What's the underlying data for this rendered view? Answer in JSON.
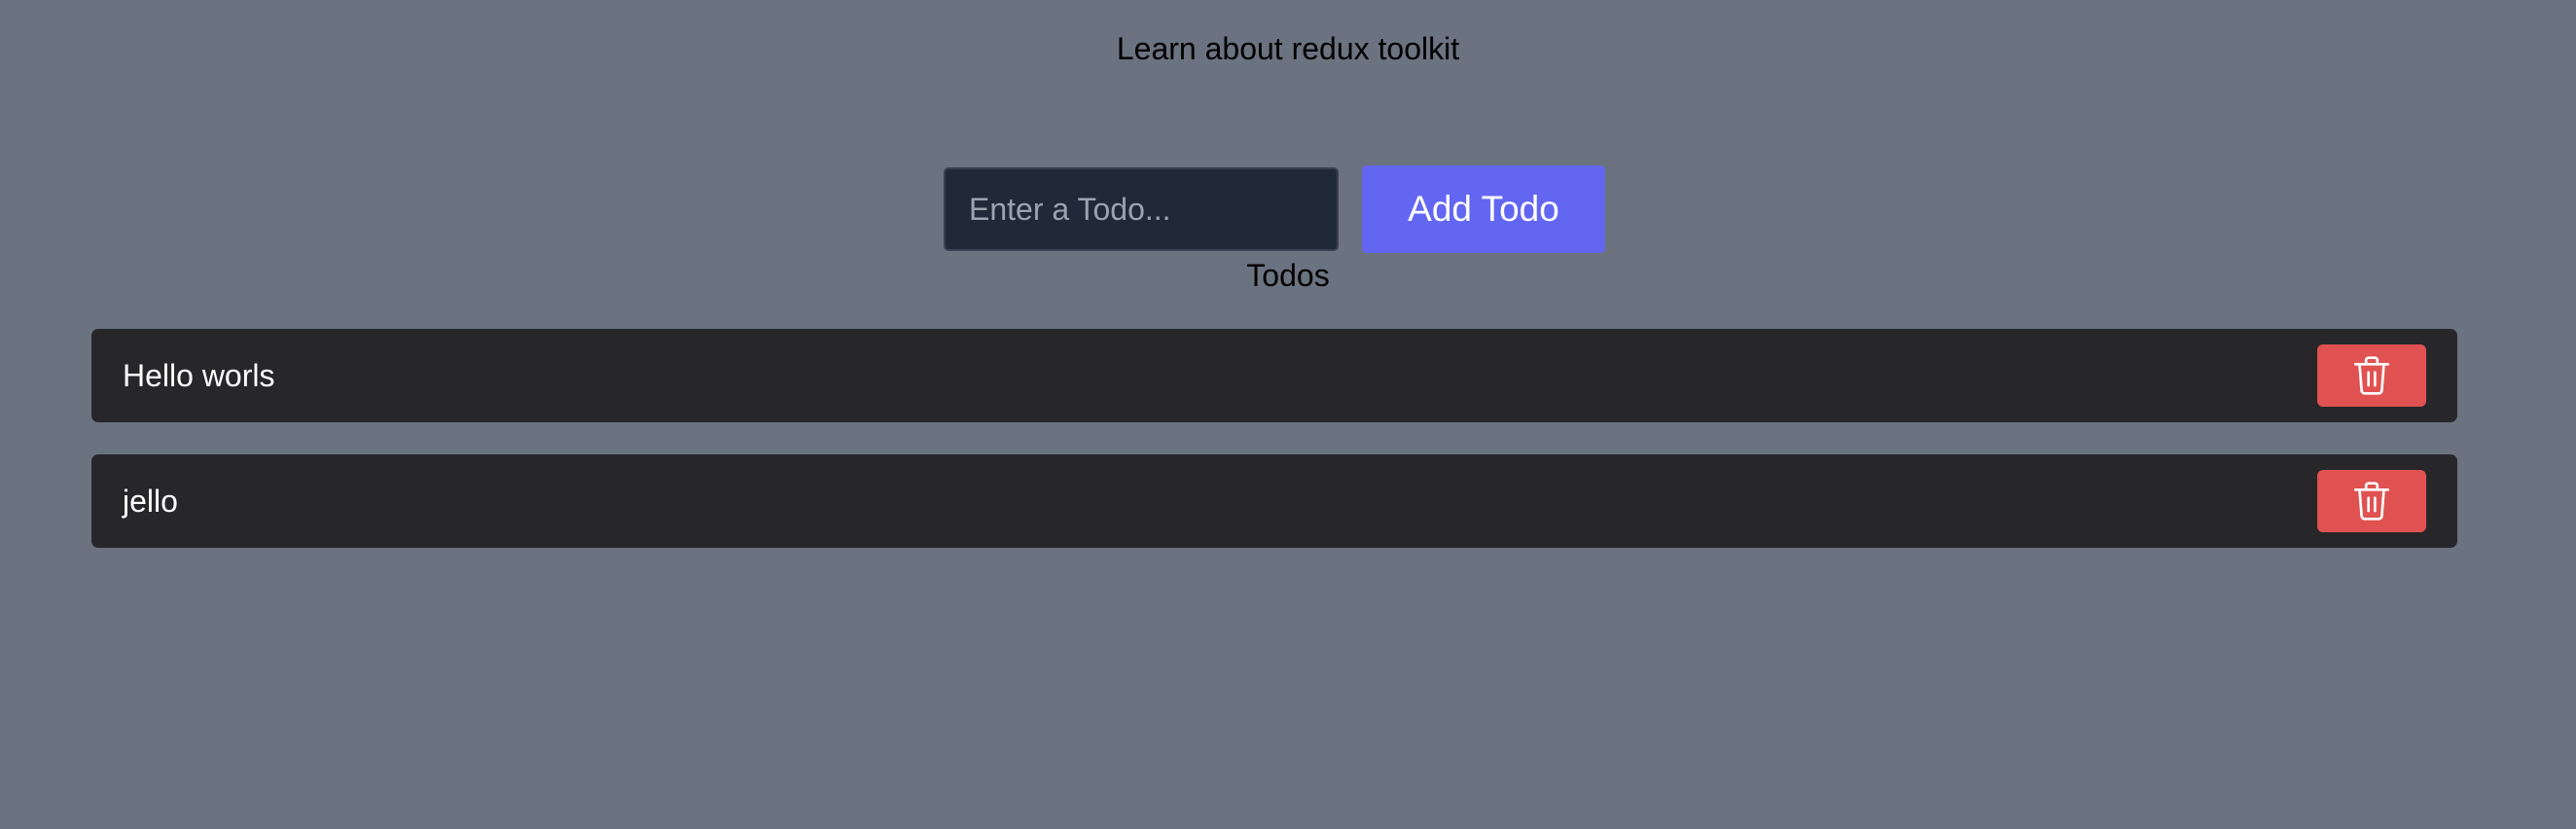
{
  "header": {
    "title": "Learn about redux toolkit"
  },
  "form": {
    "placeholder": "Enter a Todo...",
    "value": "",
    "add_label": "Add Todo"
  },
  "list": {
    "heading": "Todos",
    "items": [
      {
        "text": "Hello worls",
        "delete_icon": "trash-icon"
      },
      {
        "text": "jello",
        "delete_icon": "trash-icon"
      }
    ]
  },
  "colors": {
    "background": "#6b7280",
    "input_background": "#1f2937",
    "accent": "#6366f1",
    "item_background": "#27272a",
    "danger": "#e05252"
  }
}
